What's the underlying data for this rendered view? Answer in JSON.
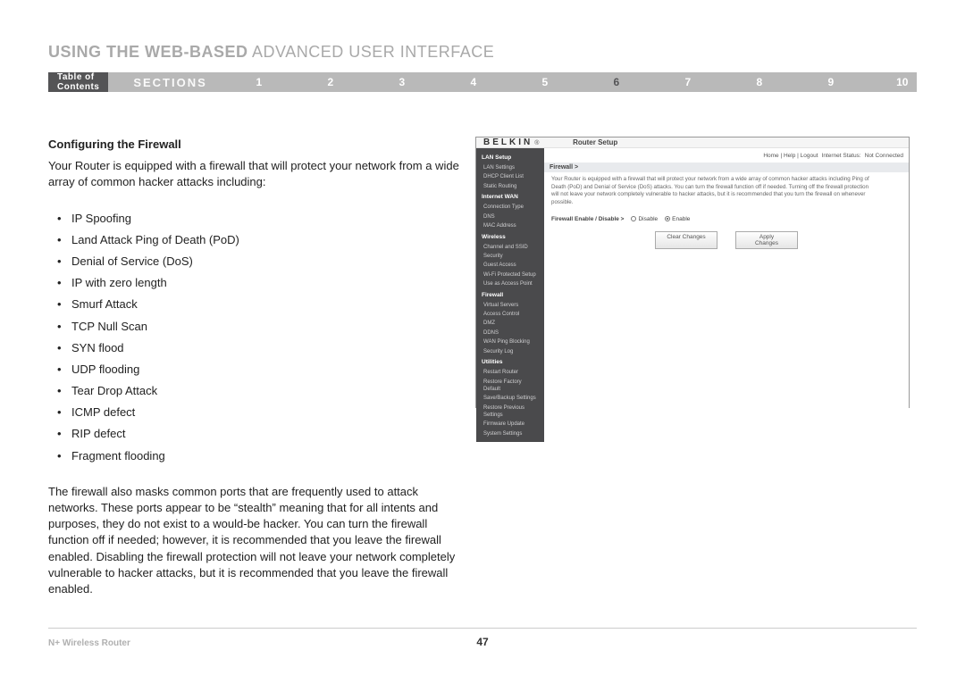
{
  "header": {
    "title_bold": "USING THE WEB-BASED",
    "title_light": " ADVANCED USER INTERFACE"
  },
  "nav": {
    "toc": "Table of Contents",
    "sections_label": "SECTIONS",
    "numbers": [
      "1",
      "2",
      "3",
      "4",
      "5",
      "6",
      "7",
      "8",
      "9",
      "10"
    ],
    "active": "6"
  },
  "left": {
    "subhead": "Configuring the Firewall",
    "intro": "Your Router is equipped with a firewall that will protect your network from a wide array of common hacker attacks including:",
    "attacks": [
      "IP Spoofing",
      "Land Attack Ping of Death (PoD)",
      "Denial of Service (DoS)",
      "IP with zero length",
      "Smurf Attack",
      "TCP Null Scan",
      "SYN flood",
      "UDP flooding",
      "Tear Drop Attack",
      "ICMP defect",
      "RIP defect",
      "Fragment flooding"
    ],
    "para2": "The firewall also masks common ports that are frequently used to attack networks. These ports appear to be “stealth” meaning that for all intents and purposes, they do not exist to a would-be hacker. You can turn the firewall function off if needed; however, it is recommended that you leave the firewall enabled. Disabling the firewall protection will not leave your network completely vulnerable to hacker attacks, but it is recommended that you leave the firewall enabled."
  },
  "router": {
    "brand": "BELKIN",
    "brand_suffix": "®",
    "header_title": "Router Setup",
    "topbar": {
      "links": "Home | Help | Logout",
      "status_label": "Internet Status:",
      "status_value": "Not Connected"
    },
    "sidebar": [
      {
        "type": "group",
        "label": "LAN Setup"
      },
      {
        "type": "item",
        "label": "LAN Settings"
      },
      {
        "type": "item",
        "label": "DHCP Client List"
      },
      {
        "type": "item",
        "label": "Static Routing"
      },
      {
        "type": "group",
        "label": "Internet WAN"
      },
      {
        "type": "item",
        "label": "Connection Type"
      },
      {
        "type": "item",
        "label": "DNS"
      },
      {
        "type": "item",
        "label": "MAC Address"
      },
      {
        "type": "group",
        "label": "Wireless"
      },
      {
        "type": "item",
        "label": "Channel and SSID"
      },
      {
        "type": "item",
        "label": "Security"
      },
      {
        "type": "item",
        "label": "Guest Access"
      },
      {
        "type": "item",
        "label": "Wi-Fi Protected Setup"
      },
      {
        "type": "item",
        "label": "Use as Access Point"
      },
      {
        "type": "group",
        "label": "Firewall"
      },
      {
        "type": "item",
        "label": "Virtual Servers"
      },
      {
        "type": "item",
        "label": "Access Control"
      },
      {
        "type": "item",
        "label": "DMZ"
      },
      {
        "type": "item",
        "label": "DDNS"
      },
      {
        "type": "item",
        "label": "WAN Ping Blocking"
      },
      {
        "type": "item",
        "label": "Security Log"
      },
      {
        "type": "group",
        "label": "Utilities"
      },
      {
        "type": "item",
        "label": "Restart Router"
      },
      {
        "type": "item",
        "label": "Restore Factory Default"
      },
      {
        "type": "item",
        "label": "Save/Backup Settings"
      },
      {
        "type": "item",
        "label": "Restore Previous Settings"
      },
      {
        "type": "item",
        "label": "Firmware Update"
      },
      {
        "type": "item",
        "label": "System Settings"
      }
    ],
    "main": {
      "breadcrumb": "Firewall >",
      "desc": "Your Router is equipped with a firewall that will protect your network from a wide array of common hacker attacks including Ping of Death (PoD) and Denial of Service (DoS) attacks. You can turn the firewall function off if needed. Turning off the firewall protection will not leave your network completely vulnerable to hacker attacks, but it is recommended that you turn the firewall on whenever possible.",
      "row_label": "Firewall Enable / Disable >",
      "opt_disable": "Disable",
      "opt_enable": "Enable",
      "btn_clear": "Clear Changes",
      "btn_apply": "Apply Changes"
    }
  },
  "footer": {
    "product": "N+ Wireless Router",
    "page": "47"
  }
}
